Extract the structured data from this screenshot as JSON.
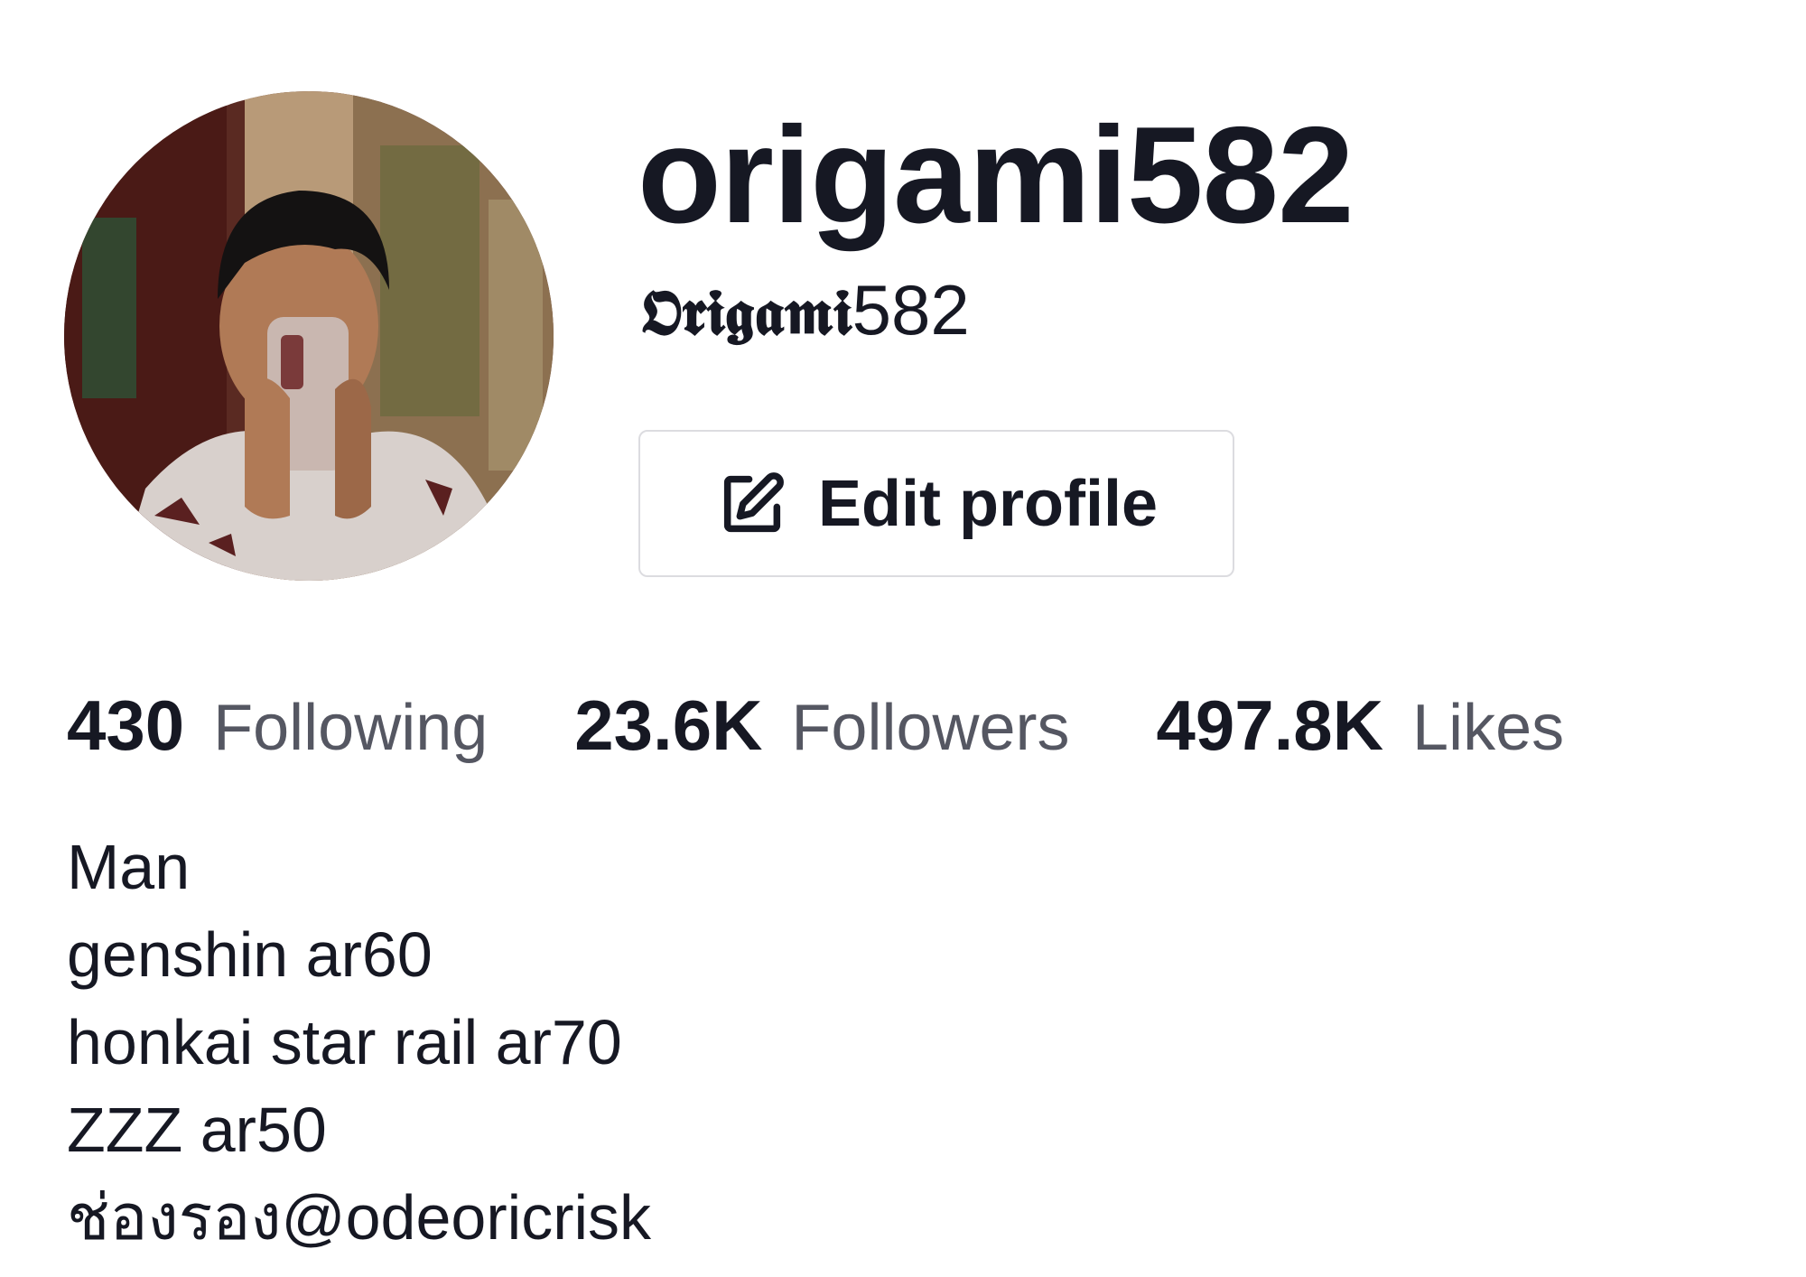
{
  "profile": {
    "username": "origami582",
    "display_name_styled": "𝕺𝖗𝖎𝖌𝖆𝖒𝖎",
    "display_name_digits": "582",
    "avatar_icon": "user-avatar-photo",
    "edit_button": {
      "label": "Edit profile",
      "icon": "edit-icon"
    }
  },
  "stats": [
    {
      "number": "430",
      "label": "Following"
    },
    {
      "number": "23.6K",
      "label": "Followers"
    },
    {
      "number": "497.8K",
      "label": "Likes"
    }
  ],
  "bio": [
    "Man",
    "genshin ar60",
    "honkai star rail ar70",
    "ZZZ ar50",
    "ช่องรอง@odeoricrisk"
  ],
  "colors": {
    "text_primary": "#161823",
    "text_secondary": "#555762",
    "button_border": "#dcdce0"
  }
}
